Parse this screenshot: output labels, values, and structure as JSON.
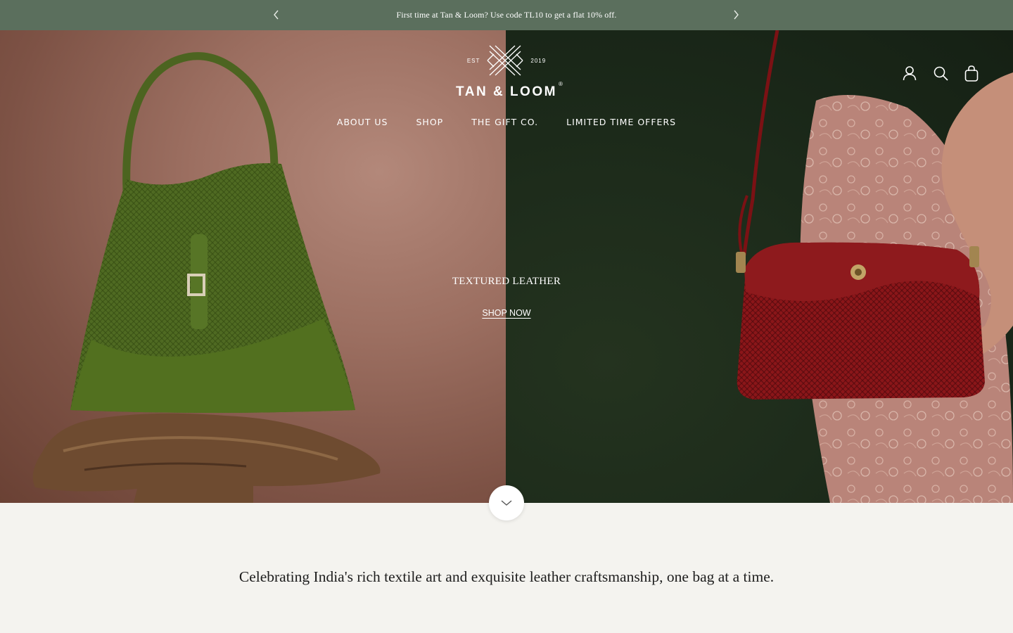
{
  "announcement": {
    "text": "First time at Tan & Loom? Use code TL10 to get a flat 10% off.",
    "background": "#5b6f5d"
  },
  "logo": {
    "est_left": "EST",
    "est_right": "2019",
    "wordmark": "TAN & LOOM",
    "registered": "®"
  },
  "nav": {
    "items": [
      {
        "label": "ABOUT US"
      },
      {
        "label": "SHOP"
      },
      {
        "label": "THE GIFT CO."
      },
      {
        "label": "LIMITED TIME OFFERS"
      }
    ]
  },
  "header_icons": [
    "account-icon",
    "search-icon",
    "cart-icon"
  ],
  "hero": {
    "title": "TEXTURED LEATHER",
    "cta": "SHOP NOW",
    "left_color": "#9c6f61",
    "right_color": "#1c2a1a"
  },
  "tagline": "Celebrating India's rich textile art and exquisite leather craftsmanship, one bag at a time."
}
